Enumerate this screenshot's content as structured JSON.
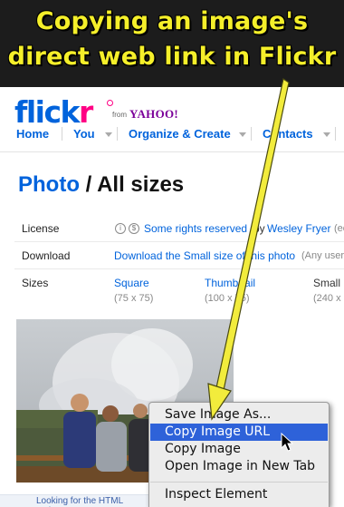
{
  "caption": {
    "line1": "Copying an image's",
    "line2": "direct web link in Flickr"
  },
  "header": {
    "logo_main": "flick",
    "logo_r": "r",
    "from_label": "from",
    "yahoo_label": "YAHOO!",
    "nav": {
      "home": "Home",
      "you": "You",
      "organize": "Organize & Create",
      "contacts": "Contacts"
    }
  },
  "page": {
    "title_link": "Photo",
    "title_rest": " / All sizes",
    "license_label": "License",
    "license_link": "Some rights reserved",
    "license_by": "by",
    "license_owner": "Wesley Fryer",
    "license_tail": "(ec",
    "download_label": "Download",
    "download_link": "Download the Small size of this photo",
    "download_note": "(Any user",
    "sizes_label": "Sizes",
    "sizes": [
      {
        "name": "Square",
        "dims": "(75 x 75)"
      },
      {
        "name": "Thumbnail",
        "dims": "(100 x 75)"
      },
      {
        "name": "Small",
        "dims": "(240 x"
      }
    ]
  },
  "context_menu": {
    "items": [
      "Save Image As...",
      "Copy Image URL",
      "Copy Image",
      "Open Image in New Tab",
      "Inspect Element"
    ],
    "highlighted_index": 1
  },
  "bottom_strip": {
    "text": "Looking for the HTML code..."
  },
  "colors": {
    "caption_yellow": "#f5ef2a",
    "flickr_blue": "#0063dc",
    "flickr_pink": "#ff0084",
    "menu_highlight": "#2e62d9"
  }
}
